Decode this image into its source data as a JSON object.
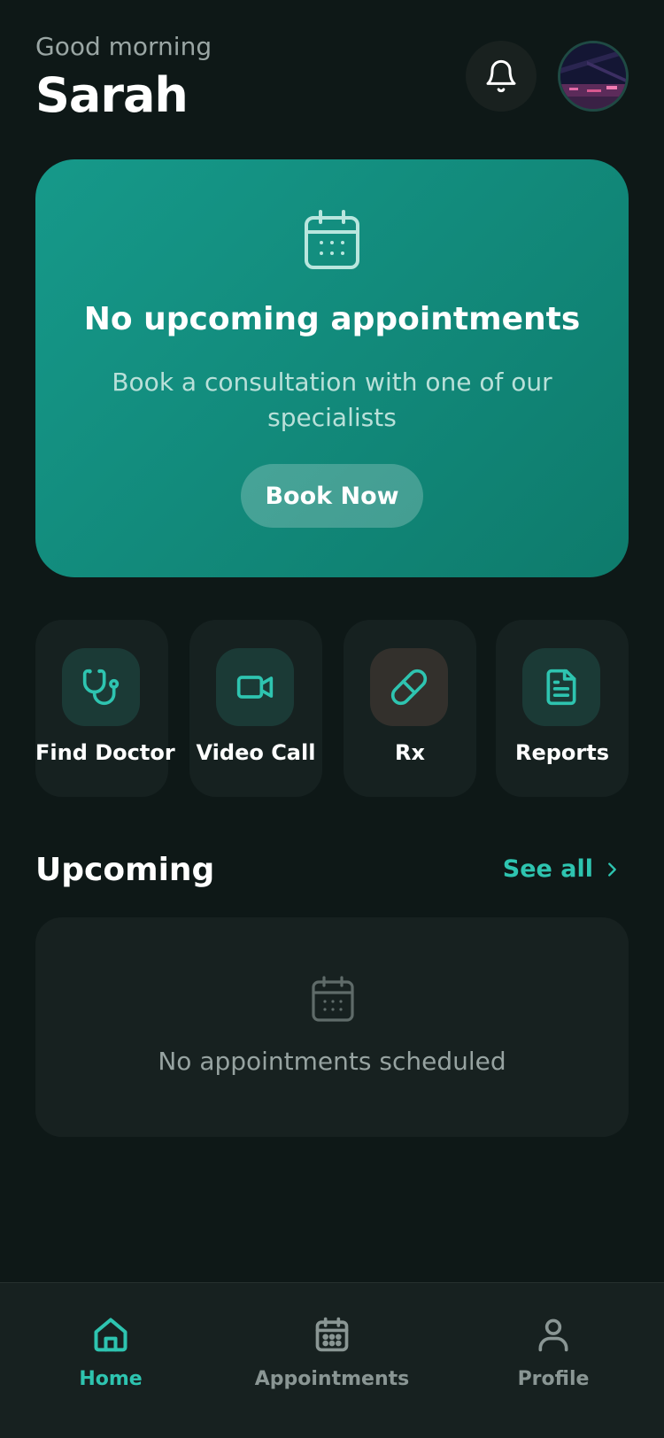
{
  "header": {
    "greeting": "Good morning",
    "name": "Sarah"
  },
  "hero": {
    "title": "No upcoming appointments",
    "subtitle": "Book a consultation with one of our specialists",
    "button_label": "Book Now"
  },
  "quick_actions": [
    {
      "label": "Find Doctor",
      "icon": "stethoscope-icon"
    },
    {
      "label": "Video Call",
      "icon": "video-camera-icon"
    },
    {
      "label": "Rx",
      "icon": "pill-icon"
    },
    {
      "label": "Reports",
      "icon": "document-icon"
    }
  ],
  "upcoming": {
    "title": "Upcoming",
    "see_all": "See all",
    "empty_text": "No appointments scheduled"
  },
  "tabbar": {
    "tabs": [
      {
        "label": "Home",
        "icon": "home-icon",
        "active": true
      },
      {
        "label": "Appointments",
        "icon": "calendar-icon",
        "active": false
      },
      {
        "label": "Profile",
        "icon": "user-icon",
        "active": false
      }
    ]
  },
  "colors": {
    "background": "#0e1817",
    "accent": "#2ec4b0",
    "hero_start": "#16998a",
    "hero_end": "#0e7b6c",
    "card": "#162120",
    "muted_text": "#97a3a1",
    "inactive_tab": "#8a9694"
  }
}
